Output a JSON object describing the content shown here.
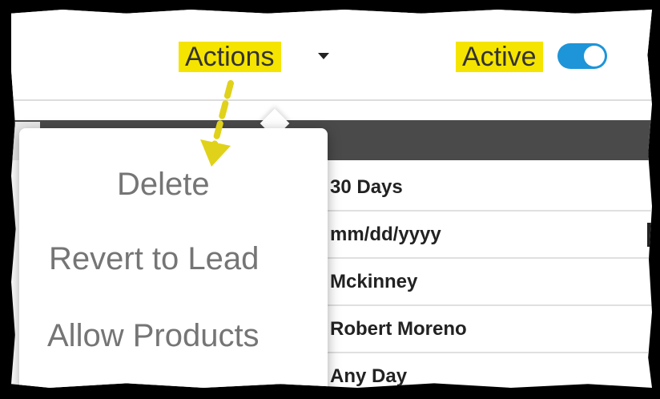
{
  "header": {
    "actions_label": "Actions",
    "active_label": "Active",
    "active_toggle_on": true,
    "highlight_color": "#f5e400",
    "toggle_color": "#1d95d8"
  },
  "actions_menu": {
    "items": [
      {
        "label": "Delete"
      },
      {
        "label": "Revert to Lead"
      },
      {
        "label": "Allow Products"
      }
    ]
  },
  "table": {
    "rows": [
      {
        "value": "30 Days"
      },
      {
        "value": "mm/dd/yyyy"
      },
      {
        "value": "Mckinney"
      },
      {
        "value": "Robert Moreno"
      },
      {
        "value": "Any Day"
      }
    ]
  },
  "annotation": {
    "arrow_color": "#e0d21a"
  }
}
